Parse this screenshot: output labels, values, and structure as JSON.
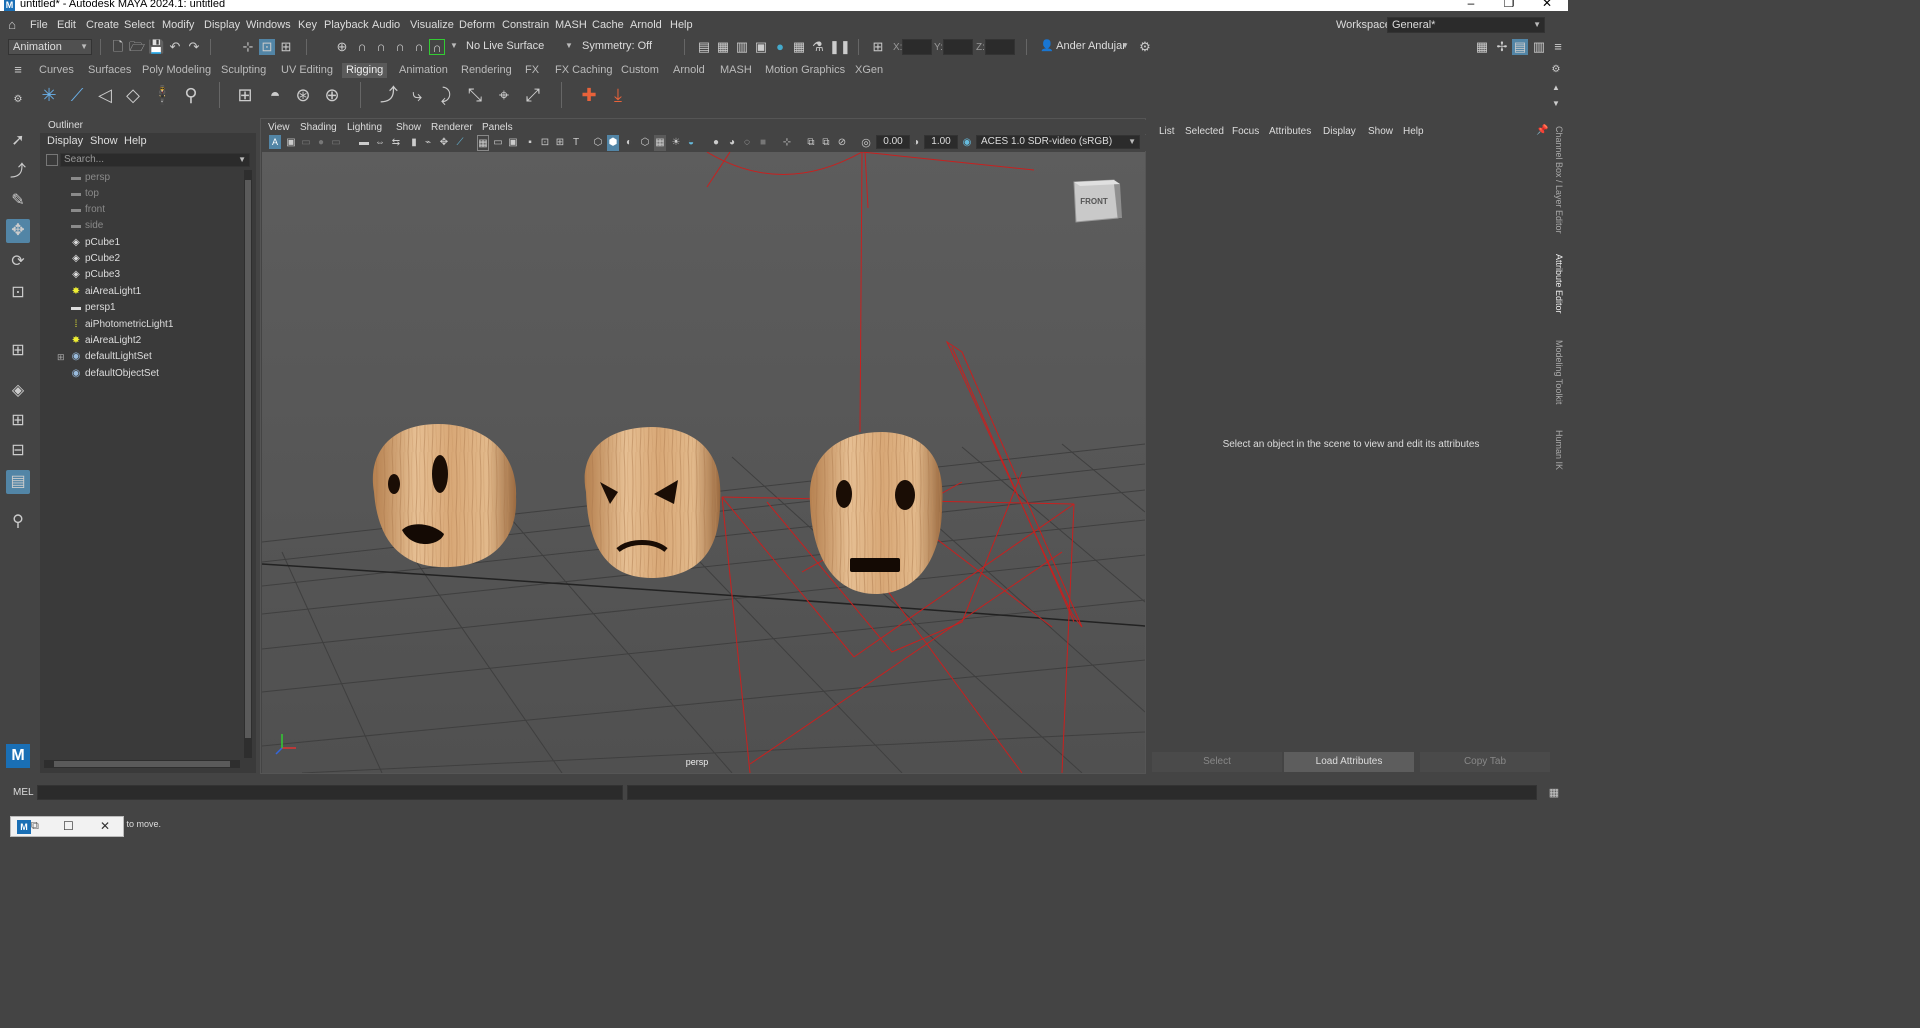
{
  "window": {
    "title": "untitled* - Autodesk MAYA 2024.1: untitled",
    "app_icon": "M"
  },
  "menubar": [
    "File",
    "Edit",
    "Create",
    "Select",
    "Modify",
    "Display",
    "Windows",
    "Key",
    "Playback",
    "Audio",
    "Visualize",
    "Deform",
    "Constrain",
    "MASH",
    "Cache",
    "Arnold",
    "Help"
  ],
  "workspace": {
    "label": "Workspace:",
    "value": "General*"
  },
  "statusline": {
    "menuset": "Animation",
    "live_surface": "No Live Surface",
    "symmetry": "Symmetry: Off",
    "x_label": "X:",
    "y_label": "Y:",
    "z_label": "Z:",
    "user": "Ander Andujar"
  },
  "shelf_tabs": [
    "Curves",
    "Surfaces",
    "Poly Modeling",
    "Sculpting",
    "UV Editing",
    "Rigging",
    "Animation",
    "Rendering",
    "FX",
    "FX Caching",
    "Custom",
    "Arnold",
    "MASH",
    "Motion Graphics",
    "XGen"
  ],
  "shelf_active": "Rigging",
  "outliner": {
    "title": "Outliner",
    "menus": [
      "Display",
      "Show",
      "Help"
    ],
    "search_placeholder": "Search...",
    "items": [
      {
        "label": "persp",
        "icon": "camera-icon",
        "dim": true
      },
      {
        "label": "top",
        "icon": "camera-icon",
        "dim": true
      },
      {
        "label": "front",
        "icon": "camera-icon",
        "dim": true
      },
      {
        "label": "side",
        "icon": "camera-icon",
        "dim": true
      },
      {
        "label": "pCube1",
        "icon": "mesh-icon",
        "dim": false
      },
      {
        "label": "pCube2",
        "icon": "mesh-icon",
        "dim": false
      },
      {
        "label": "pCube3",
        "icon": "mesh-icon",
        "dim": false
      },
      {
        "label": "aiAreaLight1",
        "icon": "area-light-icon",
        "dim": false
      },
      {
        "label": "persp1",
        "icon": "camera-icon",
        "dim": false
      },
      {
        "label": "aiPhotometricLight1",
        "icon": "photometric-light-icon",
        "dim": false
      },
      {
        "label": "aiAreaLight2",
        "icon": "area-light-icon",
        "dim": false
      },
      {
        "label": "defaultLightSet",
        "icon": "set-icon",
        "dim": false
      },
      {
        "label": "defaultObjectSet",
        "icon": "set-icon",
        "dim": false
      }
    ]
  },
  "viewport": {
    "menus": [
      "View",
      "Shading",
      "Lighting",
      "Show",
      "Renderer",
      "Panels"
    ],
    "exposure": "0.00",
    "gamma": "1.00",
    "color_space": "ACES 1.0 SDR-video (sRGB)",
    "camera_label": "persp",
    "viewcube_label": "FRONT"
  },
  "attribute_editor": {
    "menus": [
      "List",
      "Selected",
      "Focus",
      "Attributes",
      "Display",
      "Show",
      "Help"
    ],
    "message": "Select an object in the scene to view and edit its attributes",
    "buttons": [
      "Select",
      "Load Attributes",
      "Copy Tab"
    ]
  },
  "side_tabs": [
    "Channel Box / Layer Editor",
    "Attribute Editor",
    "Modeling Toolkit",
    "Human IK"
  ],
  "command_line": {
    "label": "MEL"
  },
  "help_line": {
    "text": "ct to move."
  },
  "colors": {
    "accent": "#5285a6",
    "wireframe": "#cc2222",
    "wood": "#d9a878"
  }
}
